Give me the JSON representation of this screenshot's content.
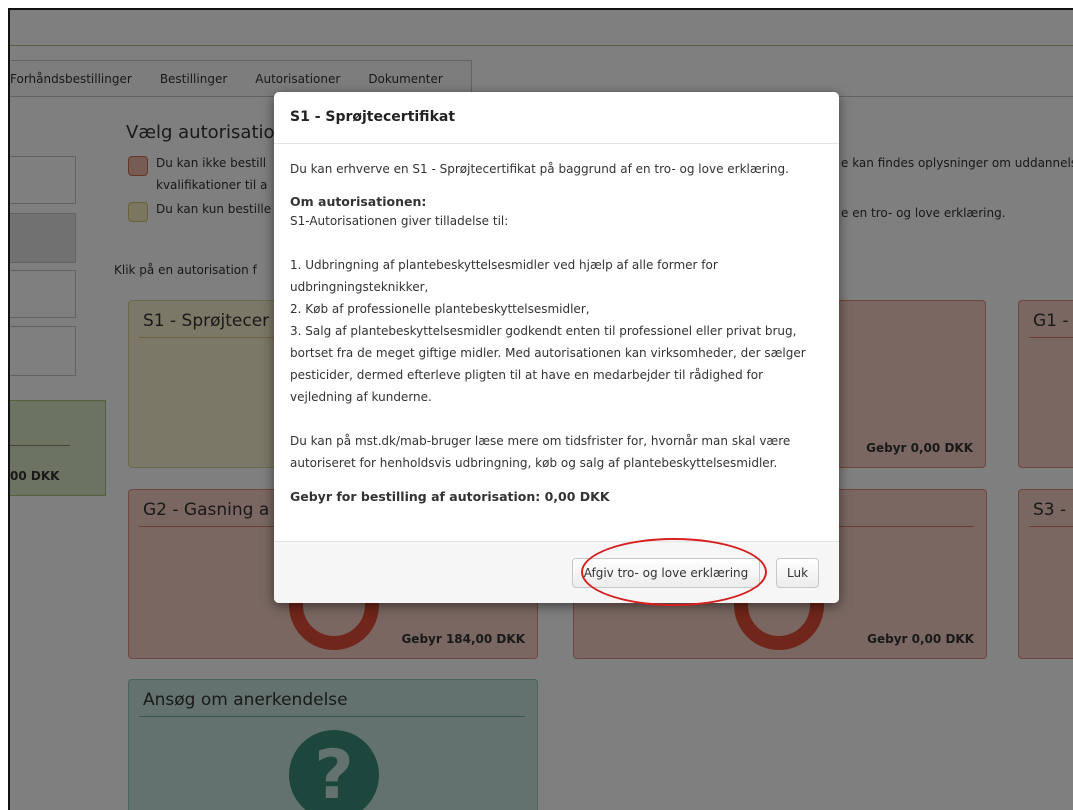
{
  "tabs": [
    "Forhåndsbestillinger",
    "Bestillinger",
    "Autorisationer",
    "Dokumenter"
  ],
  "background": {
    "heading": "Vælg autorisation",
    "legend_red_line1": "Du kan ikke bestill",
    "legend_red_line1_right": "e kan findes oplysninger om uddannels",
    "legend_red_line2": "kvalifikationer til a",
    "legend_yellow": "Du kan kun bestille",
    "legend_yellow_right": "e en tro- og love erklæring.",
    "instruction": "Klik på en autorisation f",
    "left_fee": "00 DKK"
  },
  "cards": {
    "s1_title": "S1 - Sprøjtecer",
    "g1_title": "G1 -",
    "g2_title": "G2 - Gasning a",
    "s3_title": "S3 -",
    "red1_fee": "Gebyr 0,00 DKK",
    "g2_fee": "Gebyr 184,00 DKK",
    "red2_fee": "Gebyr 0,00 DKK",
    "anerkendelse_title": "Ansøg om anerkendelse",
    "anerkendelse_icon": "?"
  },
  "modal": {
    "title": "S1 - Sprøjtecertifikat",
    "intro": "Du kan erhverve en S1 - Sprøjtecertifikat på baggrund af en tro- og love erklæring.",
    "about_heading": "Om autorisationen:",
    "about_text": "S1-Autorisationen giver tilladelse til:",
    "item1a": "1. Udbringning af plantebeskyttelsesmidler ved hjælp af alle former for",
    "item1b": "udbringningsteknikker,",
    "item2": "2. Køb af professionelle plantebeskyttelsesmidler,",
    "item3a": "3. Salg af plantebeskyttelsesmidler godkendt enten til professionel eller privat brug,",
    "item3b": "bortset fra de meget giftige midler. Med autorisationen kan virksomheder, der sælger",
    "item3c": "pesticider, dermed efterleve pligten til at have en medarbejder til rådighed for",
    "item3d": "vejledning af kunderne.",
    "info_a": "Du kan på mst.dk/mab-bruger læse mere om tidsfrister for, hvornår man skal være",
    "info_b": "autoriseret for henholdsvis udbringning, køb og salg af plantebeskyttelsesmidler.",
    "fee": "Gebyr for bestilling af autorisation: 0,00 DKK",
    "primary_button": "Afgiv tro- og love erklæring",
    "close_button": "Luk"
  },
  "colors": {
    "annotation_ring": "#d61f1f",
    "card_red": "#f5cfc3",
    "card_yellow": "#f7f1cf",
    "card_teal": "#c7e5de",
    "card_green": "#dbe6c3"
  }
}
